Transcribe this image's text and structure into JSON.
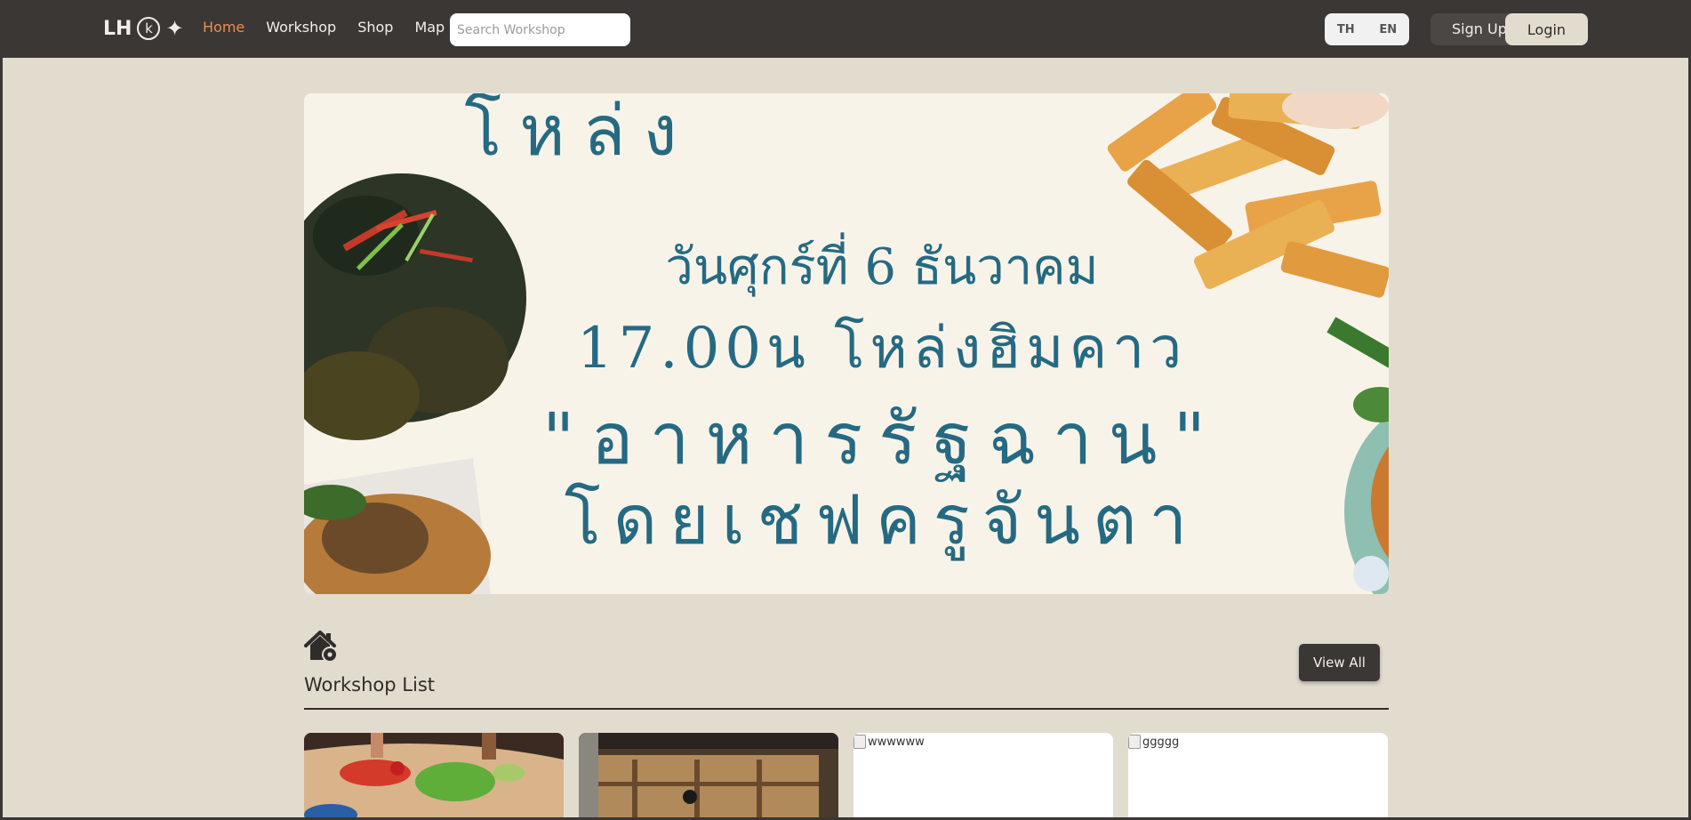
{
  "nav": {
    "logo_text": "LH",
    "logo_k": "k",
    "logo_spark": "✦",
    "links": [
      {
        "label": "Home",
        "active": true
      },
      {
        "label": "Workshop",
        "active": false
      },
      {
        "label": "Shop",
        "active": false
      },
      {
        "label": "Map",
        "active": false
      }
    ],
    "search_placeholder": "Search Workshop",
    "lang": [
      "TH",
      "EN"
    ],
    "signup_label": "Sign Up",
    "login_label": "Login"
  },
  "banner": {
    "line0": "โหล่ง",
    "line1": "วันศุกร์ที่ 6 ธันวาคม",
    "line2": "17.00น โหล่งฮิมคาว",
    "line3": "\"อาหารรัฐฉาน\"",
    "line4": "โดยเชฟครูจันตา"
  },
  "section": {
    "title": "Workshop List",
    "view_all_label": "View All",
    "icon": "house-gear-icon"
  },
  "cards": [
    {
      "alt": ""
    },
    {
      "alt": ""
    },
    {
      "alt": "wwwwww"
    },
    {
      "alt": "ggggg"
    }
  ],
  "colors": {
    "navbar": "#3a3735",
    "background": "#e2dccf",
    "active_link": "#ee8c56",
    "banner_text": "#256a82"
  }
}
